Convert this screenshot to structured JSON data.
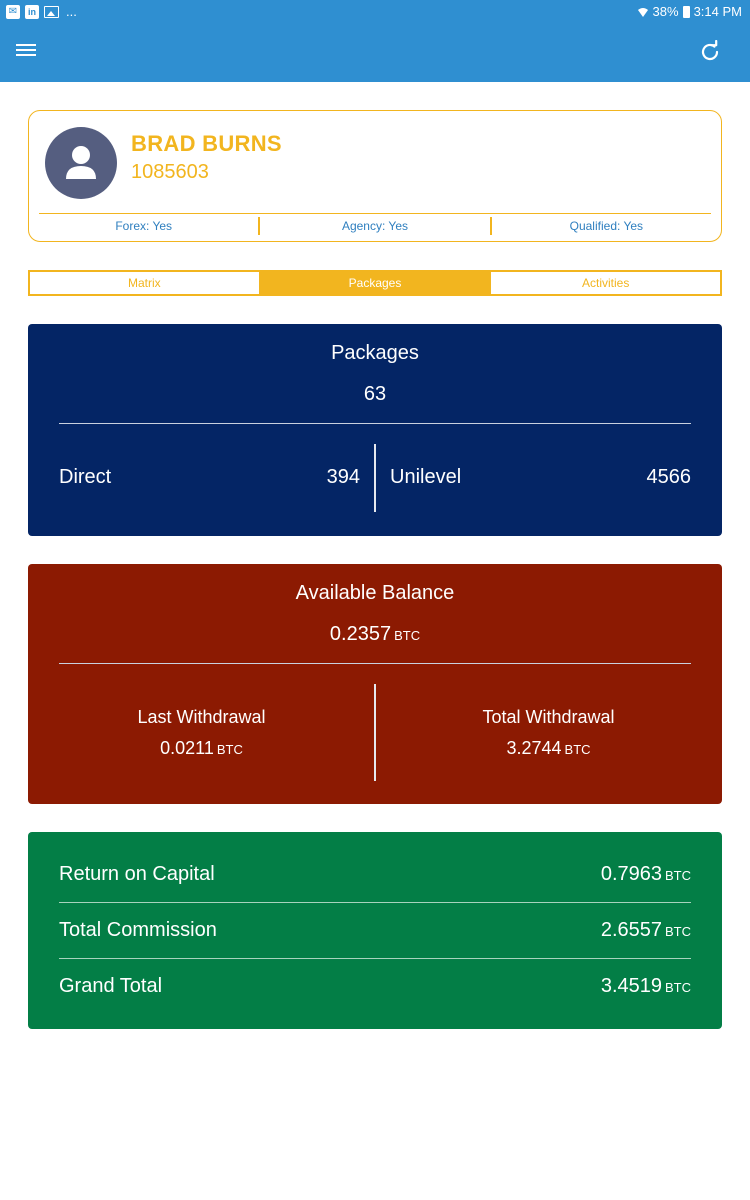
{
  "status_bar": {
    "more": "...",
    "battery": "38%",
    "time": "3:14 PM",
    "icons": [
      "notification-icon",
      "linkedin-icon",
      "gallery-icon",
      "wifi-icon",
      "battery-icon"
    ]
  },
  "app_bar": {
    "background_color": "#2f8fd1",
    "icons": [
      "menu-icon",
      "refresh-icon"
    ]
  },
  "profile": {
    "name": "BRAD BURNS",
    "id": "1085603",
    "accent_color": "#f2b51f",
    "flags": [
      {
        "label": "Forex: Yes"
      },
      {
        "label": "Agency: Yes"
      },
      {
        "label": "Qualified: Yes"
      }
    ]
  },
  "tabs": [
    {
      "label": "Matrix",
      "active": false
    },
    {
      "label": "Packages",
      "active": true
    },
    {
      "label": "Activities",
      "active": false
    }
  ],
  "packages_card": {
    "title": "Packages",
    "count": "63",
    "direct_label": "Direct",
    "direct_value": "394",
    "unilevel_label": "Unilevel",
    "unilevel_value": "4566",
    "color": "#042565"
  },
  "balance_card": {
    "title": "Available Balance",
    "value": "0.2357",
    "unit": "BTC",
    "last_withdrawal_label": "Last Withdrawal",
    "last_withdrawal_value": "0.0211",
    "total_withdrawal_label": "Total Withdrawal",
    "total_withdrawal_value": "3.2744",
    "color": "#8c1a02"
  },
  "totals_card": {
    "color": "#037e46",
    "unit": "BTC",
    "rows": [
      {
        "label": "Return on Capital",
        "value": "0.7963"
      },
      {
        "label": "Total Commission",
        "value": "2.6557"
      },
      {
        "label": "Grand Total",
        "value": "3.4519"
      }
    ]
  }
}
